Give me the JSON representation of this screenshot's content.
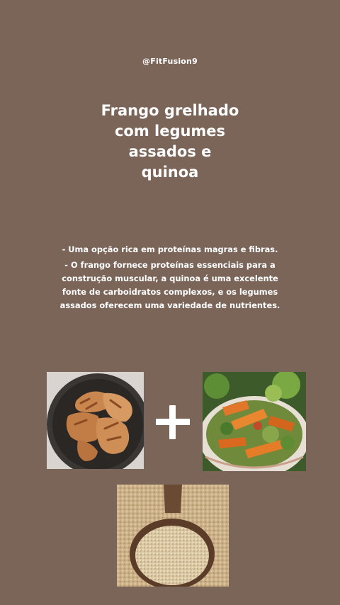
{
  "handle": "@FitFusion9",
  "title": {
    "lines": [
      "Frango grelhado",
      "com legumes",
      "assados e",
      "quinoa"
    ]
  },
  "bullets": [
    "- Uma opção rica em proteínas magras e fibras.",
    "- O frango fornece proteínas essenciais para a construção muscular, a quinoa é uma excelente fonte de carboidratos complexos, e os legumes assados oferecem uma variedade de nutrientes."
  ],
  "images": {
    "chicken": "grilled-chicken-photo",
    "plus": "plus-icon",
    "vegetables": "roasted-vegetables-photo",
    "quinoa": "quinoa-spoon-photo"
  },
  "colors": {
    "background": "#7b6559",
    "text": "#ffffff"
  }
}
